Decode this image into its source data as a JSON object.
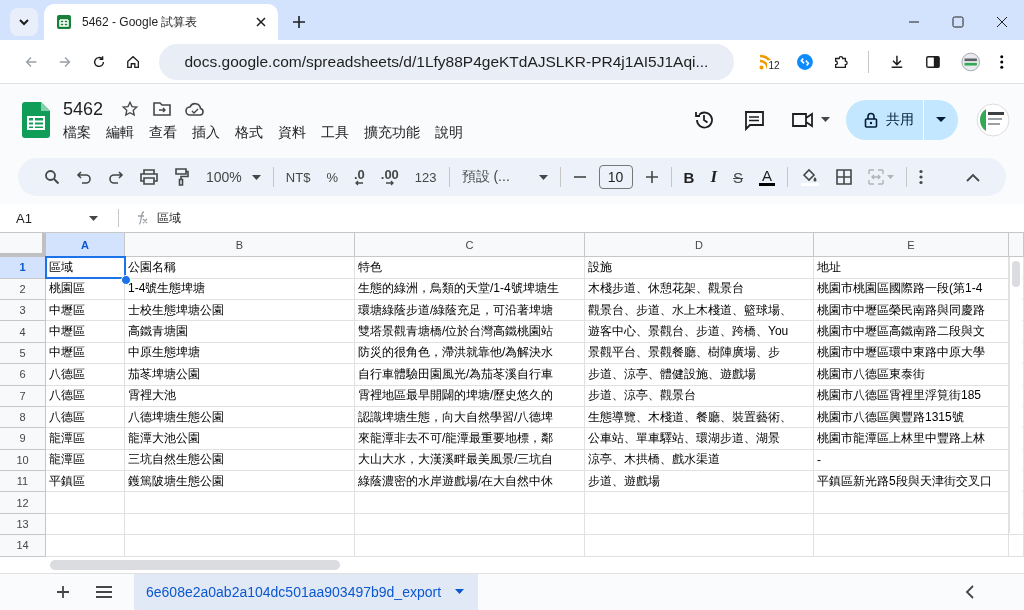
{
  "browser": {
    "tab_title": "5462 - Google 試算表",
    "url": "docs.google.com/spreadsheets/d/1Lfy88P4geKTdAJSLKR-PR4j1AI5J1Aqi...",
    "extension_badge": "12"
  },
  "doc": {
    "title": "5462",
    "menus": [
      "檔案",
      "編輯",
      "查看",
      "插入",
      "格式",
      "資料",
      "工具",
      "擴充功能",
      "說明"
    ],
    "share_label": "共用"
  },
  "toolbar": {
    "zoom": "100%",
    "currency": "NT$",
    "percent": "%",
    "decimal_decrease": ".0",
    "decimal_increase": ".00",
    "number_format": "123",
    "font": "預設 (...",
    "font_size": "10",
    "bold": "B",
    "italic": "I",
    "strikethrough": "S",
    "text_color": "A"
  },
  "formula_bar": {
    "cell_ref": "A1",
    "formula": "區域"
  },
  "grid": {
    "columns": [
      {
        "label": "A",
        "selected": true
      },
      {
        "label": "B",
        "selected": false
      },
      {
        "label": "C",
        "selected": false
      },
      {
        "label": "D",
        "selected": false
      },
      {
        "label": "E",
        "selected": false
      }
    ],
    "rows": [
      {
        "number": "1",
        "selected": true,
        "cells": [
          "區域",
          "公園名稱",
          "特色",
          "設施",
          "地址"
        ]
      },
      {
        "number": "2",
        "selected": false,
        "cells": [
          "桃園區",
          "1-4號生態埤塘",
          "生態的綠洲，鳥類的天堂/1-4號埤塘生",
          "木棧步道、休憩花架、觀景台",
          "桃園市桃園區國際路一段(第1-4"
        ]
      },
      {
        "number": "3",
        "selected": false,
        "cells": [
          "中壢區",
          "士校生態埤塘公園",
          "環塘綠蔭步道/綠蔭充足，可沿著埤塘",
          "觀景台、步道、水上木棧道、籃球場、",
          "桃園市中壢區榮民南路與同慶路"
        ]
      },
      {
        "number": "4",
        "selected": false,
        "cells": [
          "中壢區",
          "高鐵青塘園",
          "雙塔景觀青塘橋/位於台灣高鐵桃園站",
          "遊客中心、景觀台、步道、跨橋、You",
          "桃園市中壢區高鐵南路二段與文"
        ]
      },
      {
        "number": "5",
        "selected": false,
        "cells": [
          "中壢區",
          "中原生態埤塘",
          "防災的很角色，滯洪就靠他/為解決水",
          "景觀平台、景觀餐廳、樹陣廣場、步",
          "桃園市中壢區環中東路中原大學"
        ]
      },
      {
        "number": "6",
        "selected": false,
        "cells": [
          "八德區",
          "茄苳埤塘公園",
          "自行車體驗田園風光/為茄苳溪自行車",
          "步道、涼亭、體健設施、遊戲場",
          "桃園市八德區東泰街"
        ]
      },
      {
        "number": "7",
        "selected": false,
        "cells": [
          "八德區",
          "霄裡大池",
          "霄裡地區最早開闢的埤塘/歷史悠久的",
          "步道、涼亭、觀景台",
          "桃園市八德區霄裡里浮筧街185"
        ]
      },
      {
        "number": "8",
        "selected": false,
        "cells": [
          "八德區",
          "八德埤塘生態公園",
          "認識埤塘生態，向大自然學習/八德埤",
          "生態導覽、木棧道、餐廳、裝置藝術、",
          "桃園市八德區興豐路1315號"
        ]
      },
      {
        "number": "9",
        "selected": false,
        "cells": [
          "龍潭區",
          "龍潭大池公園",
          "來龍潭非去不可/龍潭最重要地標，鄰",
          "公車站、單車驛站、環湖步道、湖景",
          "桃園市龍潭區上林里中豐路上林"
        ]
      },
      {
        "number": "10",
        "selected": false,
        "cells": [
          "龍潭區",
          "三坑自然生態公園",
          "大山大水，大漢溪畔最美風景/三坑自",
          "涼亭、木拱橋、戲水渠道",
          "-"
        ]
      },
      {
        "number": "11",
        "selected": false,
        "cells": [
          "平鎮區",
          "鑊篤陂塘生態公園",
          "綠蔭濃密的水岸遊戲場/在大自然中休",
          "步道、遊戲場",
          "平鎮區新光路5段與天津街交叉口"
        ]
      },
      {
        "number": "12",
        "selected": false,
        "cells": []
      },
      {
        "number": "13",
        "selected": false,
        "cells": []
      },
      {
        "number": "14",
        "selected": false,
        "cells": []
      }
    ]
  },
  "sheet_tabs": [
    {
      "label": "6e608e2a0ab2a104dc501aa903497b9d_export",
      "selected": true
    }
  ]
}
